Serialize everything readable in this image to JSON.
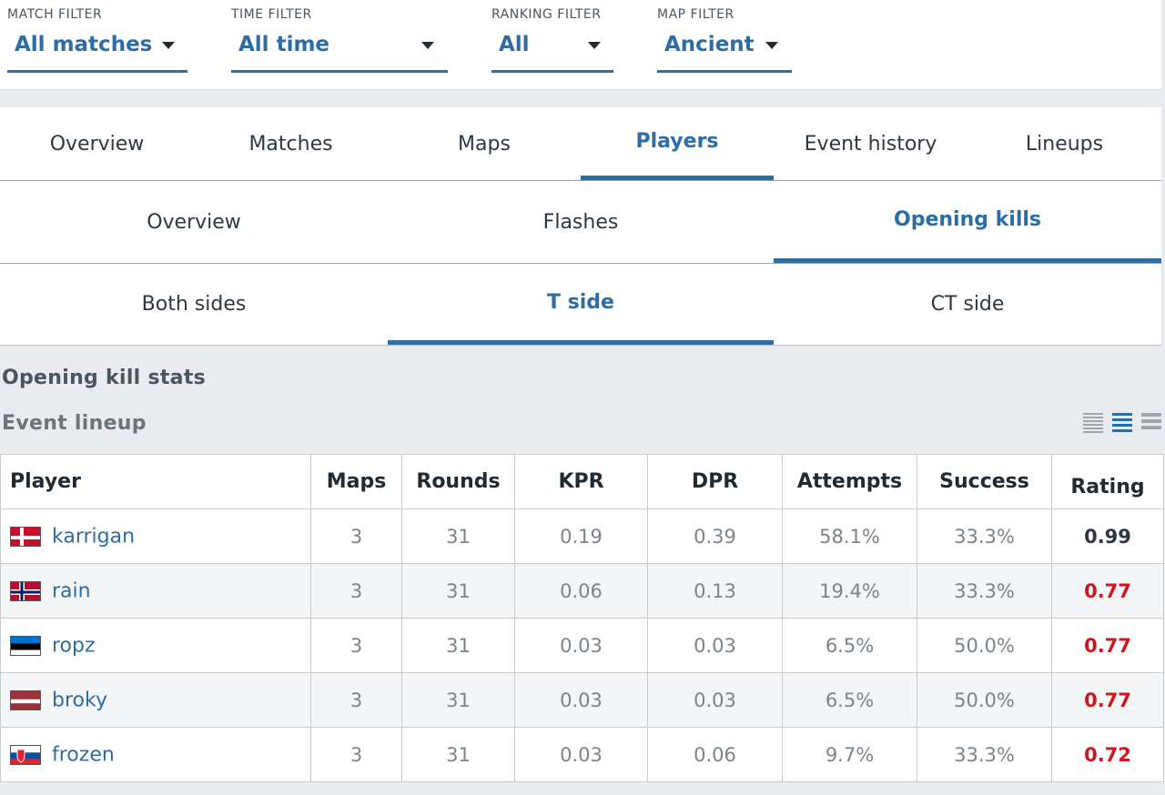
{
  "filters": [
    {
      "label": "MATCH FILTER",
      "value": "All matches"
    },
    {
      "label": "TIME FILTER",
      "value": "All time"
    },
    {
      "label": "RANKING FILTER",
      "value": "All"
    },
    {
      "label": "MAP FILTER",
      "value": "Ancient"
    }
  ],
  "main_tabs": [
    "Overview",
    "Matches",
    "Maps",
    "Players",
    "Event history",
    "Lineups"
  ],
  "main_tabs_active": "Players",
  "sub_tabs": [
    "Overview",
    "Flashes",
    "Opening kills"
  ],
  "sub_tabs_active": "Opening kills",
  "side_tabs": [
    "Both sides",
    "T side",
    "CT side"
  ],
  "side_tabs_active": "T side",
  "section_title": "Opening kill stats",
  "lineup_label": "Event lineup",
  "view_icons": [
    "list-dense-icon",
    "list-medium-icon",
    "list-wide-icon"
  ],
  "colors": {
    "accent": "#2d6da3",
    "rating_bad": "#d0161c",
    "rating_neutral": "#2d3844"
  },
  "table": {
    "headers": [
      "Player",
      "Maps",
      "Rounds",
      "KPR",
      "DPR",
      "Attempts",
      "Success",
      "Rating"
    ],
    "rows": [
      {
        "flag": "denmark",
        "player": "karrigan",
        "maps": "3",
        "rounds": "31",
        "kpr": "0.19",
        "dpr": "0.39",
        "attempts": "58.1%",
        "success": "33.3%",
        "rating": "0.99"
      },
      {
        "flag": "norway",
        "player": "rain",
        "maps": "3",
        "rounds": "31",
        "kpr": "0.06",
        "dpr": "0.13",
        "attempts": "19.4%",
        "success": "33.3%",
        "rating": "0.77"
      },
      {
        "flag": "estonia",
        "player": "ropz",
        "maps": "3",
        "rounds": "31",
        "kpr": "0.03",
        "dpr": "0.03",
        "attempts": "6.5%",
        "success": "50.0%",
        "rating": "0.77"
      },
      {
        "flag": "latvia",
        "player": "broky",
        "maps": "3",
        "rounds": "31",
        "kpr": "0.03",
        "dpr": "0.03",
        "attempts": "6.5%",
        "success": "50.0%",
        "rating": "0.77"
      },
      {
        "flag": "slovakia",
        "player": "frozen",
        "maps": "3",
        "rounds": "31",
        "kpr": "0.03",
        "dpr": "0.06",
        "attempts": "9.7%",
        "success": "33.3%",
        "rating": "0.72"
      }
    ]
  }
}
